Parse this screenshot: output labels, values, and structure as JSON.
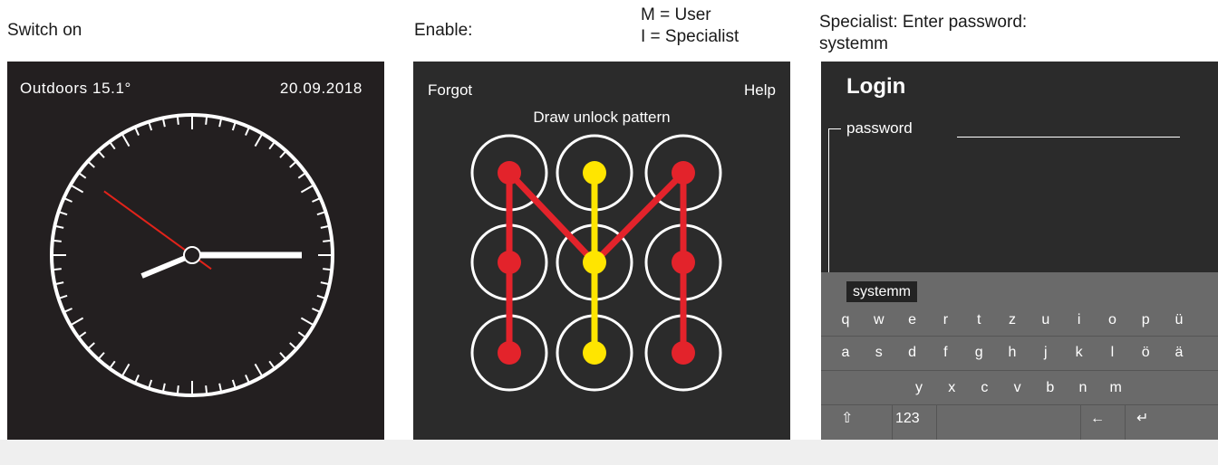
{
  "captions": {
    "switch_on": "Switch on",
    "enable": "Enable:",
    "mode_user": "M = User",
    "mode_specialist": "I = Specialist",
    "specialist_line1": "Specialist: Enter password:",
    "specialist_line2": "systemm"
  },
  "clock_screen": {
    "outdoor": "Outdoors 15.1°",
    "date": "20.09.2018",
    "time_shown": {
      "hours": 8,
      "minutes": 15,
      "seconds": 51
    },
    "colors": {
      "background": "#231f20",
      "hands": "#ffffff",
      "second_hand": "#e2231a"
    }
  },
  "pattern_screen": {
    "forgot": "Forgot",
    "help": "Help",
    "title": "Draw unlock pattern",
    "grid": [
      [
        1,
        2,
        3
      ],
      [
        4,
        5,
        6
      ],
      [
        7,
        8,
        9
      ]
    ],
    "red_path_left": [
      7,
      4,
      1,
      5,
      3,
      6,
      9
    ],
    "yellow_path": [
      2,
      5,
      8
    ],
    "colors": {
      "red": "#e3232b",
      "yellow": "#ffe500",
      "ring": "#ffffff"
    }
  },
  "login_screen": {
    "title": "Login",
    "password_label": "password",
    "entered_text": "systemm",
    "keyboard": {
      "row1": [
        "q",
        "w",
        "e",
        "r",
        "t",
        "z",
        "u",
        "i",
        "o",
        "p",
        "ü"
      ],
      "row2": [
        "a",
        "s",
        "d",
        "f",
        "g",
        "h",
        "j",
        "k",
        "l",
        "ö",
        "ä"
      ],
      "row3": [
        "y",
        "x",
        "c",
        "v",
        "b",
        "n",
        "m"
      ],
      "shift_icon": "⇧",
      "numbers": "123",
      "backspace_icon": "←",
      "enter_icon": "↵"
    }
  }
}
